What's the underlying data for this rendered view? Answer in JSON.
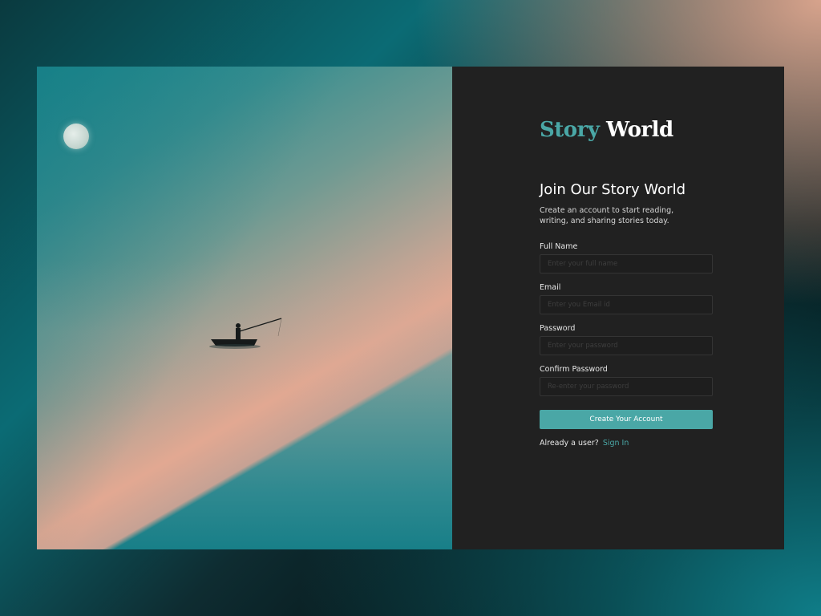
{
  "brand": {
    "part1": "Story",
    "part2": "World",
    "accent_color": "#4aa7a6"
  },
  "hero": {
    "title": "Join Our Story World",
    "subtitle": "Create an account to start reading, writing, and sharing stories today."
  },
  "form": {
    "fields": [
      {
        "label": "Full Name",
        "placeholder": "Enter your full name",
        "value": ""
      },
      {
        "label": "Email",
        "placeholder": "Enter you Email id",
        "value": ""
      },
      {
        "label": "Password",
        "placeholder": "Enter your password",
        "value": ""
      },
      {
        "label": "Confirm Password",
        "placeholder": "Re-enter your password",
        "value": ""
      }
    ],
    "submit_label": "Create Your Account",
    "existing_user_text": "Already a user?",
    "signin_link": "Sign In"
  },
  "colors": {
    "panel_bg": "#212121",
    "button_bg": "#4aa7a6",
    "input_border": "#343434"
  }
}
